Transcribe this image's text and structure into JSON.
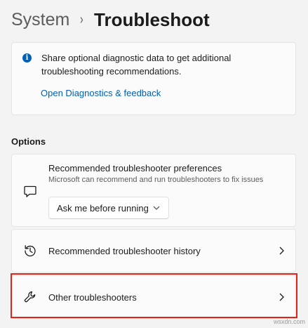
{
  "breadcrumb": {
    "parent": "System",
    "separator": "›",
    "current": "Troubleshoot"
  },
  "info_card": {
    "icon": "info-icon",
    "text": "Share optional diagnostic data to get additional troubleshooting recommendations.",
    "link": "Open Diagnostics & feedback"
  },
  "options": {
    "heading": "Options",
    "preferences": {
      "icon": "chat-bubble-icon",
      "title": "Recommended troubleshooter preferences",
      "description": "Microsoft can recommend and run troubleshooters to fix issues",
      "dropdown_value": "Ask me before running"
    },
    "history": {
      "icon": "history-icon",
      "label": "Recommended troubleshooter history"
    },
    "other": {
      "icon": "wrench-icon",
      "label": "Other troubleshooters"
    }
  },
  "highlight_color": "#e2231a",
  "accent_color": "#005fb8",
  "watermark": "wsxdn.com"
}
